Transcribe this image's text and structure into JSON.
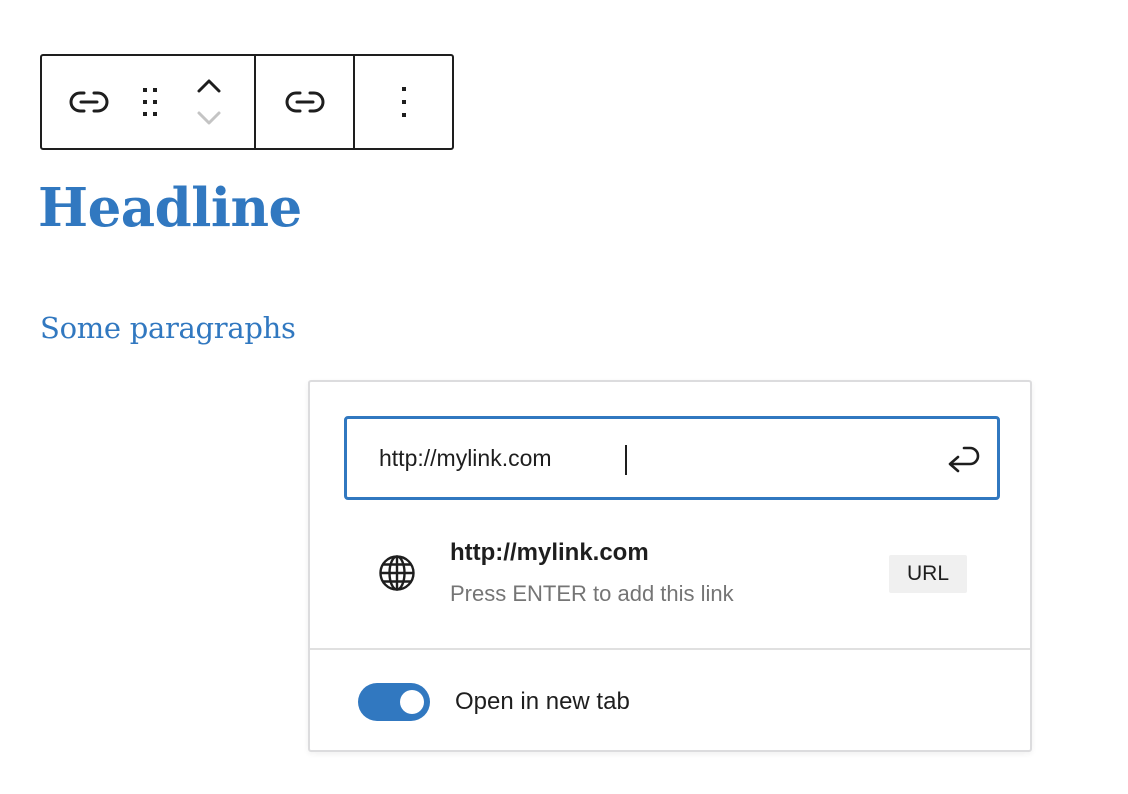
{
  "toolbar": {
    "items": [
      {
        "name": "block-type",
        "icon": "link-icon"
      },
      {
        "name": "drag",
        "icon": "drag-handle-icon"
      },
      {
        "name": "move-up",
        "icon": "chevron-up-icon"
      },
      {
        "name": "move-down",
        "icon": "chevron-down-icon",
        "disabled": true
      },
      {
        "name": "link",
        "icon": "link-icon"
      },
      {
        "name": "options",
        "icon": "more-vertical-icon"
      }
    ]
  },
  "content": {
    "headline": "Headline",
    "paragraph": "Some paragraphs"
  },
  "link_popover": {
    "url_input": {
      "value": "http://mylink.com",
      "submit_icon": "enter-return-icon"
    },
    "suggestion": {
      "icon": "globe-icon",
      "title": "http://mylink.com",
      "info": "Press ENTER to add this link",
      "type": "URL"
    },
    "settings": {
      "open_in_new_tab_label": "Open in new tab",
      "open_in_new_tab": true
    }
  },
  "colors": {
    "accent": "#3178c0",
    "text": "#1e1e1e",
    "muted": "#757575",
    "border": "#dcdcde"
  }
}
